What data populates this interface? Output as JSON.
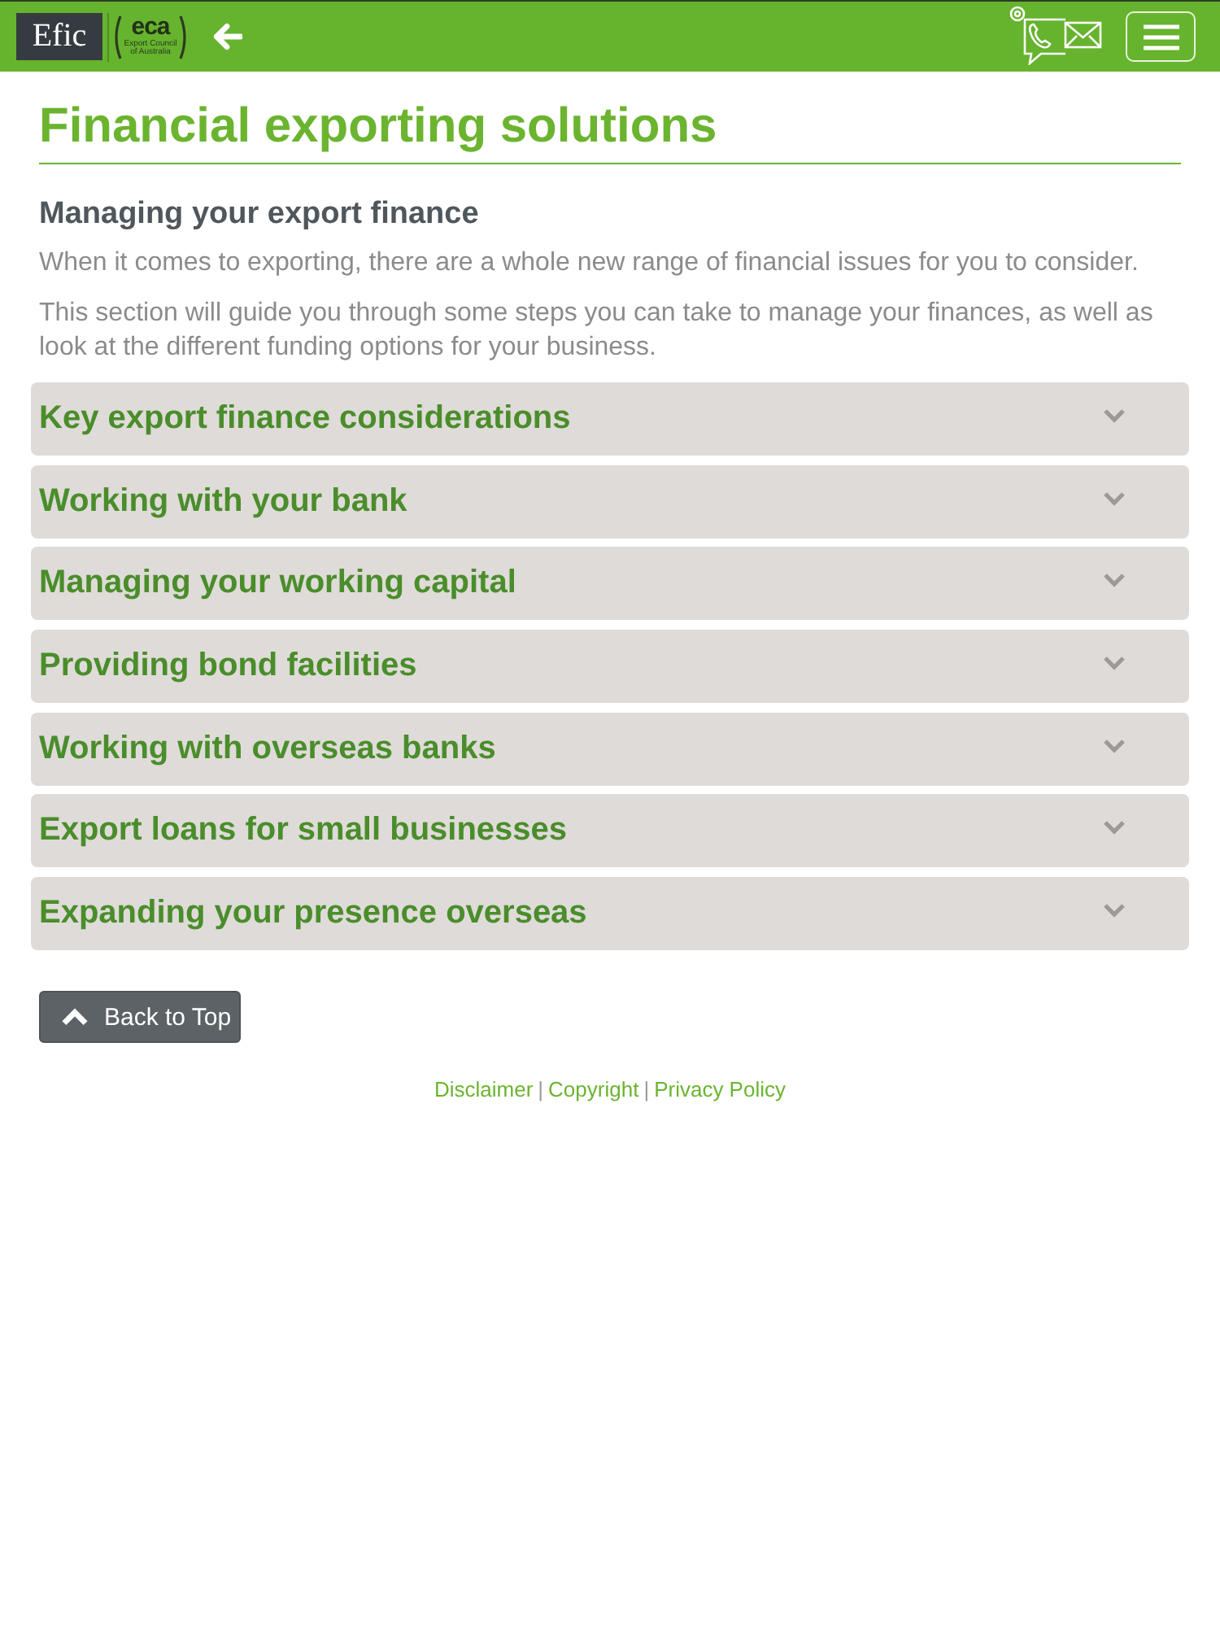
{
  "header": {
    "logo": "Efic",
    "partner_logo": {
      "mark": "eca",
      "caption": "Export Council of Australia"
    }
  },
  "page": {
    "title": "Financial exporting solutions",
    "subtitle": "Managing your export finance",
    "paragraphs": [
      "When it comes to exporting, there are a whole new range of financial issues for you to consider.",
      "This section will guide you through some steps you can take to manage your finances, as well as look at the different funding options for your business."
    ]
  },
  "sections": [
    {
      "title": "Key export finance considerations",
      "expanded": false
    },
    {
      "title": "Working with your bank",
      "expanded": false
    },
    {
      "title": "Managing your working capital",
      "expanded": false
    },
    {
      "title": "Providing bond facilities",
      "expanded": false
    },
    {
      "title": "Working with overseas banks",
      "expanded": false
    },
    {
      "title": "Export loans for small businesses",
      "expanded": false
    },
    {
      "title": "Expanding your presence overseas",
      "expanded": false
    }
  ],
  "back_to_top": {
    "label": "Back to Top"
  },
  "footer": {
    "items": [
      {
        "kind": "link",
        "text": "Disclaimer"
      },
      {
        "kind": "separator",
        "text": "|"
      },
      {
        "kind": "link",
        "text": "Copyright"
      },
      {
        "kind": "separator",
        "text": "|"
      },
      {
        "kind": "link",
        "text": "Privacy Policy"
      }
    ]
  }
}
